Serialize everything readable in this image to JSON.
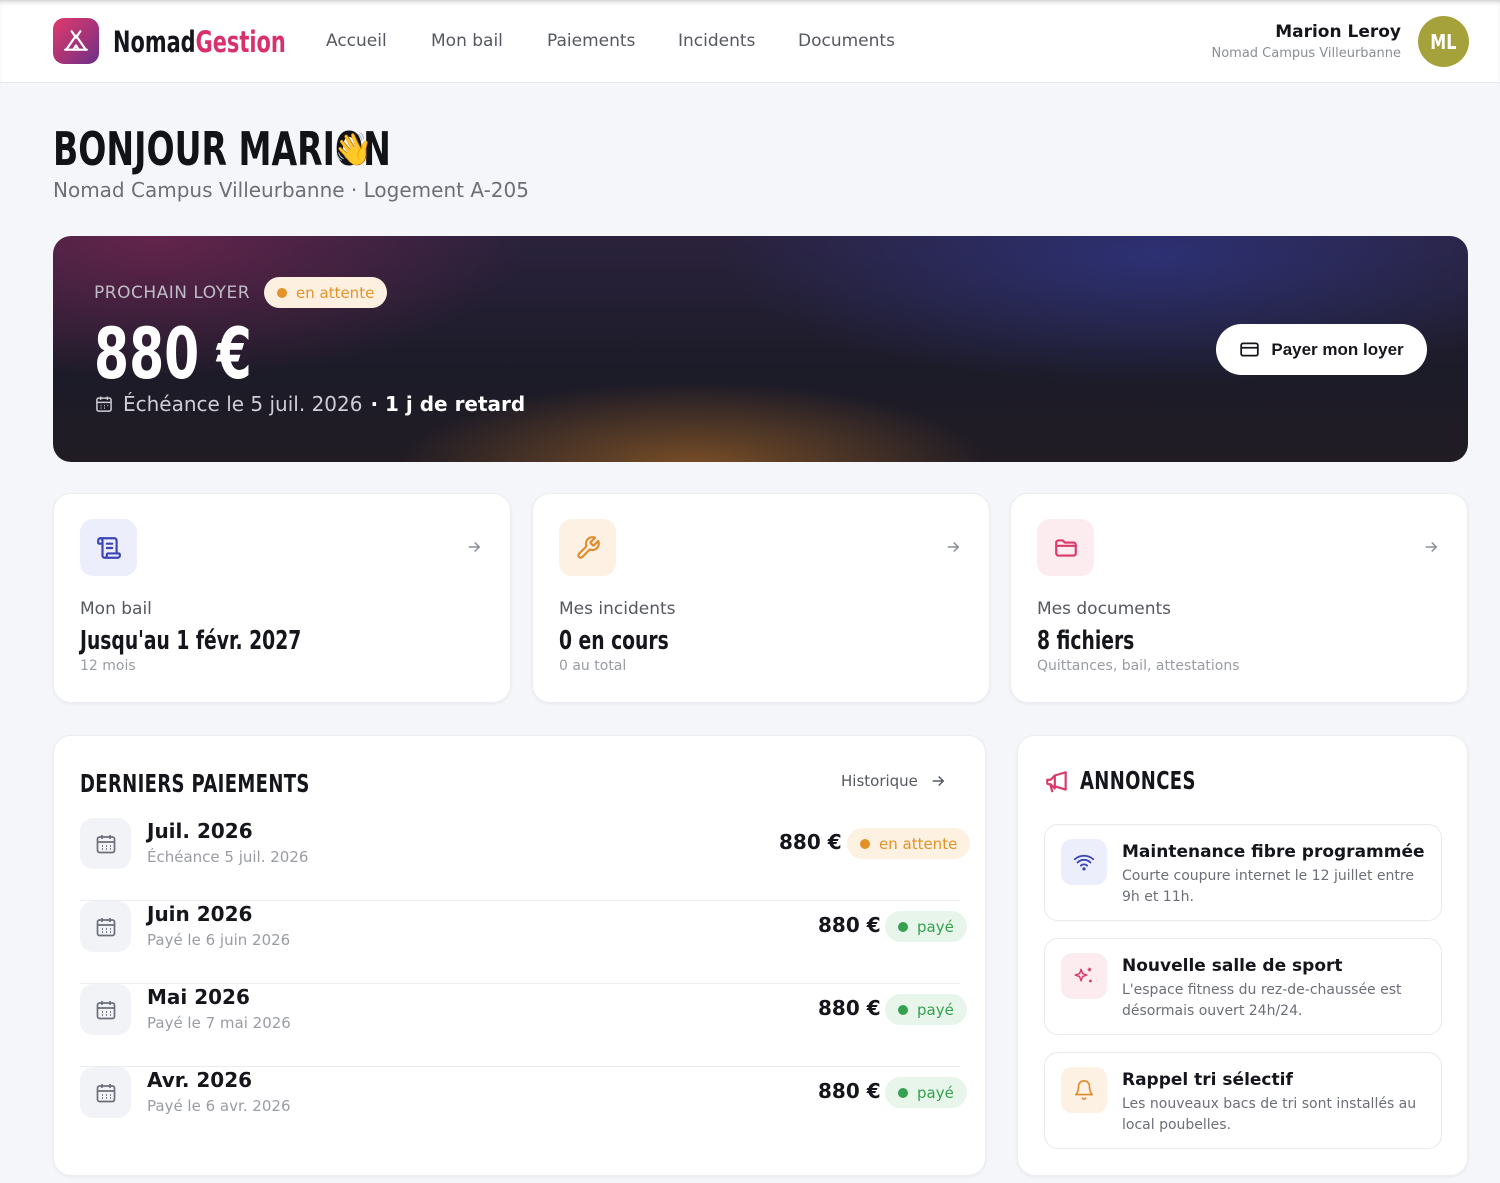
{
  "brand": {
    "part1": "Nomad",
    "part2": "Gestion"
  },
  "nav": {
    "items": [
      "Accueil",
      "Mon bail",
      "Paiements",
      "Incidents",
      "Documents"
    ]
  },
  "user": {
    "name": "Marion Leroy",
    "residence": "Nomad Campus Villeurbanne",
    "initials": "ML"
  },
  "greeting": {
    "title": "BONJOUR MARION",
    "emoji": "👋",
    "subtitle": "Nomad Campus Villeurbanne · Logement A-205"
  },
  "rent": {
    "label": "PROCHAIN LOYER",
    "status": "en attente",
    "amount": "880 €",
    "due": "Échéance le 5 juil. 2026",
    "late": "· 1 j de retard",
    "pay_button": "Payer mon loyer"
  },
  "stats": [
    {
      "label": "Mon bail",
      "value": "Jusqu'au 1 févr. 2027",
      "sub": "12 mois",
      "icon": "scroll-icon"
    },
    {
      "label": "Mes incidents",
      "value": "0 en cours",
      "sub": "0 au total",
      "icon": "wrench-icon"
    },
    {
      "label": "Mes documents",
      "value": "8 fichiers",
      "sub": "Quittances, bail, attestations",
      "icon": "folder-icon"
    }
  ],
  "payments": {
    "title": "DERNIERS PAIEMENTS",
    "history_link": "Historique",
    "rows": [
      {
        "month": "Juil. 2026",
        "sub": "Échéance 5 juil. 2026",
        "amount": "880 €",
        "status": "en attente"
      },
      {
        "month": "Juin 2026",
        "sub": "Payé le 6 juin 2026",
        "amount": "880 €",
        "status": "payé"
      },
      {
        "month": "Mai 2026",
        "sub": "Payé le 7 mai 2026",
        "amount": "880 €",
        "status": "payé"
      },
      {
        "month": "Avr. 2026",
        "sub": "Payé le 6 avr. 2026",
        "amount": "880 €",
        "status": "payé"
      }
    ]
  },
  "announcements": {
    "title": "ANNONCES",
    "items": [
      {
        "title": "Maintenance fibre programmée",
        "text": "Courte coupure internet le 12 juillet entre 9h et 11h.",
        "icon": "wifi-icon"
      },
      {
        "title": "Nouvelle salle de sport",
        "text": "L'espace fitness du rez-de-chaussée est désormais ouvert 24h/24.",
        "icon": "sparkles-icon"
      },
      {
        "title": "Rappel tri sélectif",
        "text": "Les nouveaux bacs de tri sont installés au local poubelles.",
        "icon": "bell-icon"
      }
    ]
  },
  "colors": {
    "brand_pink": "#d92f6c",
    "pending": "#e39127",
    "paid": "#35a14f",
    "avatar": "#a6a23b"
  }
}
